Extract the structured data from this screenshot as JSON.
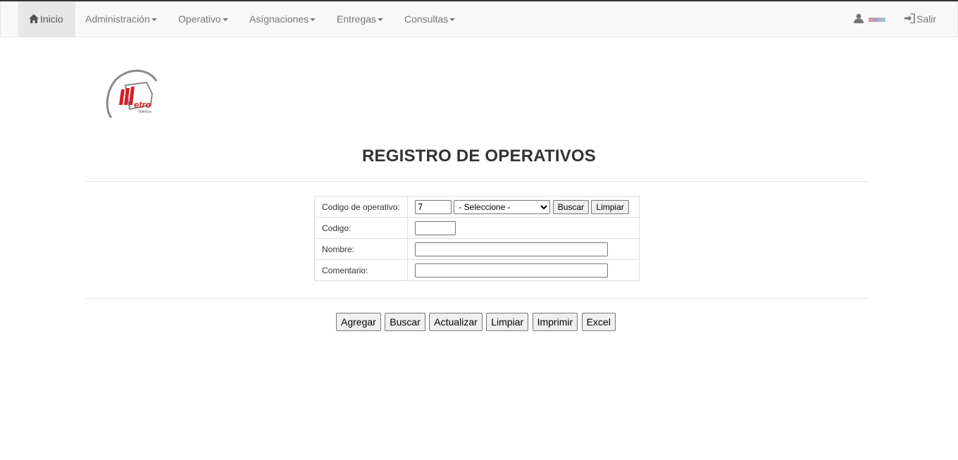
{
  "nav": {
    "home": "Inicio",
    "items": [
      "Administración",
      "Operativo",
      "Asígnaciones",
      "Entregas",
      "Consultas"
    ],
    "user_icon": "user-icon",
    "logout": "Salir",
    "logout_icon": "sign-in-icon"
  },
  "logo": {
    "text": "etro",
    "subtext": "Valencia",
    "color": "#d32027"
  },
  "page": {
    "title": "REGISTRO DE OPERATIVOS"
  },
  "form": {
    "codigo_operativo_label": "Codigo de operativo:",
    "codigo_operativo_value": "7",
    "select_value": "- Seleccione -",
    "buscar": "Buscar",
    "limpiar": "Limpiar",
    "codigo_label": "Codigo:",
    "codigo_value": "",
    "nombre_label": "Nombre:",
    "nombre_value": "",
    "comentario_label": "Comentario:",
    "comentario_value": ""
  },
  "actions": [
    "Agregar",
    "Buscar",
    "Actualizar",
    "Limpiar",
    "Imprimir",
    "Excel"
  ]
}
